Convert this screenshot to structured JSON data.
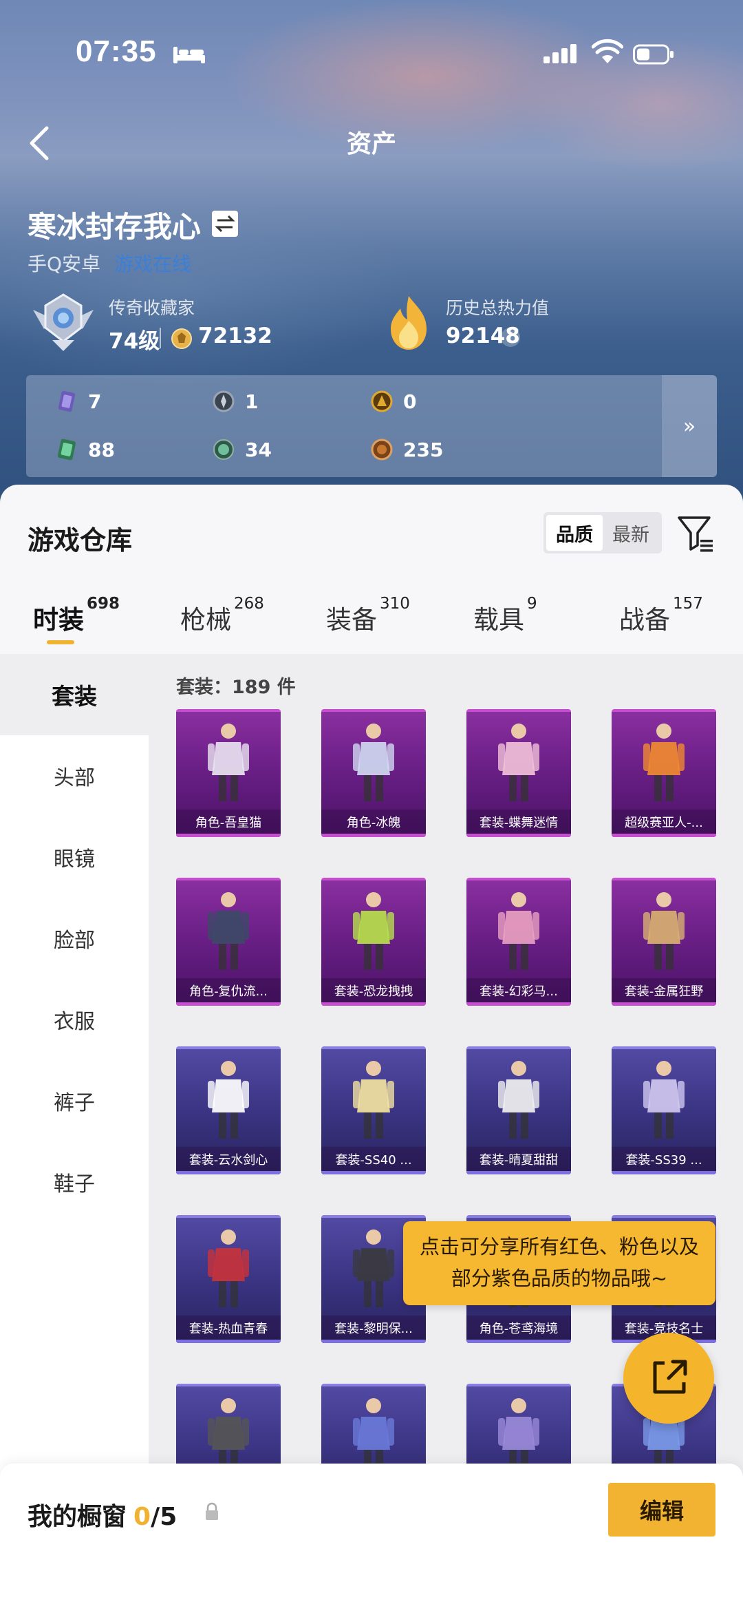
{
  "status_bar": {
    "time": "07:35"
  },
  "header": {
    "title": "资产"
  },
  "profile": {
    "name": "寒冰封存我心",
    "platform": "手Q安卓",
    "online_status": "游戏在线",
    "rank_label": "传奇收藏家",
    "level": "74级",
    "coins": "72132",
    "heat_label": "历史总热力值",
    "heat_value": "92148",
    "help": "?"
  },
  "resources": [
    {
      "icon": "card-icon",
      "value": "7",
      "color": "#6c5ab8"
    },
    {
      "icon": "compass-icon",
      "value": "1",
      "color": "#9aa4b2"
    },
    {
      "icon": "gold-medal-icon",
      "value": "0",
      "color": "#e0a930"
    },
    {
      "icon": "ticket-icon",
      "value": "88",
      "color": "#3aa56a"
    },
    {
      "icon": "orb-icon",
      "value": "34",
      "color": "#4f9a7c"
    },
    {
      "icon": "bronze-coin-icon",
      "value": "235",
      "color": "#c7782e"
    }
  ],
  "resources_more": "»",
  "warehouse": {
    "title": "游戏仓库",
    "sort": [
      "品质",
      "最新"
    ],
    "tabs": [
      {
        "label": "时装",
        "count": "698"
      },
      {
        "label": "枪械",
        "count": "268"
      },
      {
        "label": "装备",
        "count": "310"
      },
      {
        "label": "载具",
        "count": "9"
      },
      {
        "label": "战备",
        "count": "157"
      }
    ],
    "side_nav": [
      "套装",
      "头部",
      "眼镜",
      "脸部",
      "衣服",
      "裤子",
      "鞋子"
    ],
    "grid_header": "套装：189 件",
    "items": [
      {
        "name": "角色-吾皇猫",
        "rarity": "purple"
      },
      {
        "name": "角色-冰魄",
        "rarity": "purple"
      },
      {
        "name": "套装-蝶舞迷情",
        "rarity": "purple"
      },
      {
        "name": "超级赛亚人-...",
        "rarity": "purple"
      },
      {
        "name": "角色-复仇流...",
        "rarity": "purple"
      },
      {
        "name": "套装-恐龙拽拽",
        "rarity": "purple"
      },
      {
        "name": "套装-幻彩马...",
        "rarity": "purple"
      },
      {
        "name": "套装-金属狂野",
        "rarity": "purple"
      },
      {
        "name": "套装-云水剑心",
        "rarity": "blue"
      },
      {
        "name": "套装-SS40 ...",
        "rarity": "blue"
      },
      {
        "name": "套装-晴夏甜甜",
        "rarity": "blue"
      },
      {
        "name": "套装-SS39 ...",
        "rarity": "blue"
      },
      {
        "name": "套装-热血青春",
        "rarity": "blue"
      },
      {
        "name": "套装-黎明保...",
        "rarity": "blue"
      },
      {
        "name": "角色-苍鸢海境",
        "rarity": "blue"
      },
      {
        "name": "套装-竞技名士",
        "rarity": "blue"
      },
      {
        "name": "",
        "rarity": "blue"
      },
      {
        "name": "",
        "rarity": "blue"
      },
      {
        "name": "",
        "rarity": "blue"
      },
      {
        "name": "",
        "rarity": "blue"
      }
    ],
    "tooltip_line1": "点击可分享所有红色、粉色以及",
    "tooltip_line2": "部分紫色品质的物品哦~"
  },
  "showcase": {
    "label": "我的橱窗",
    "current": "0",
    "max": "/5",
    "edit": "编辑"
  },
  "colors": {
    "accent": "#f2b232",
    "online": "#3a7fd8",
    "purple_rarity": "#c64fd0",
    "blue_rarity": "#7c6fe0"
  }
}
